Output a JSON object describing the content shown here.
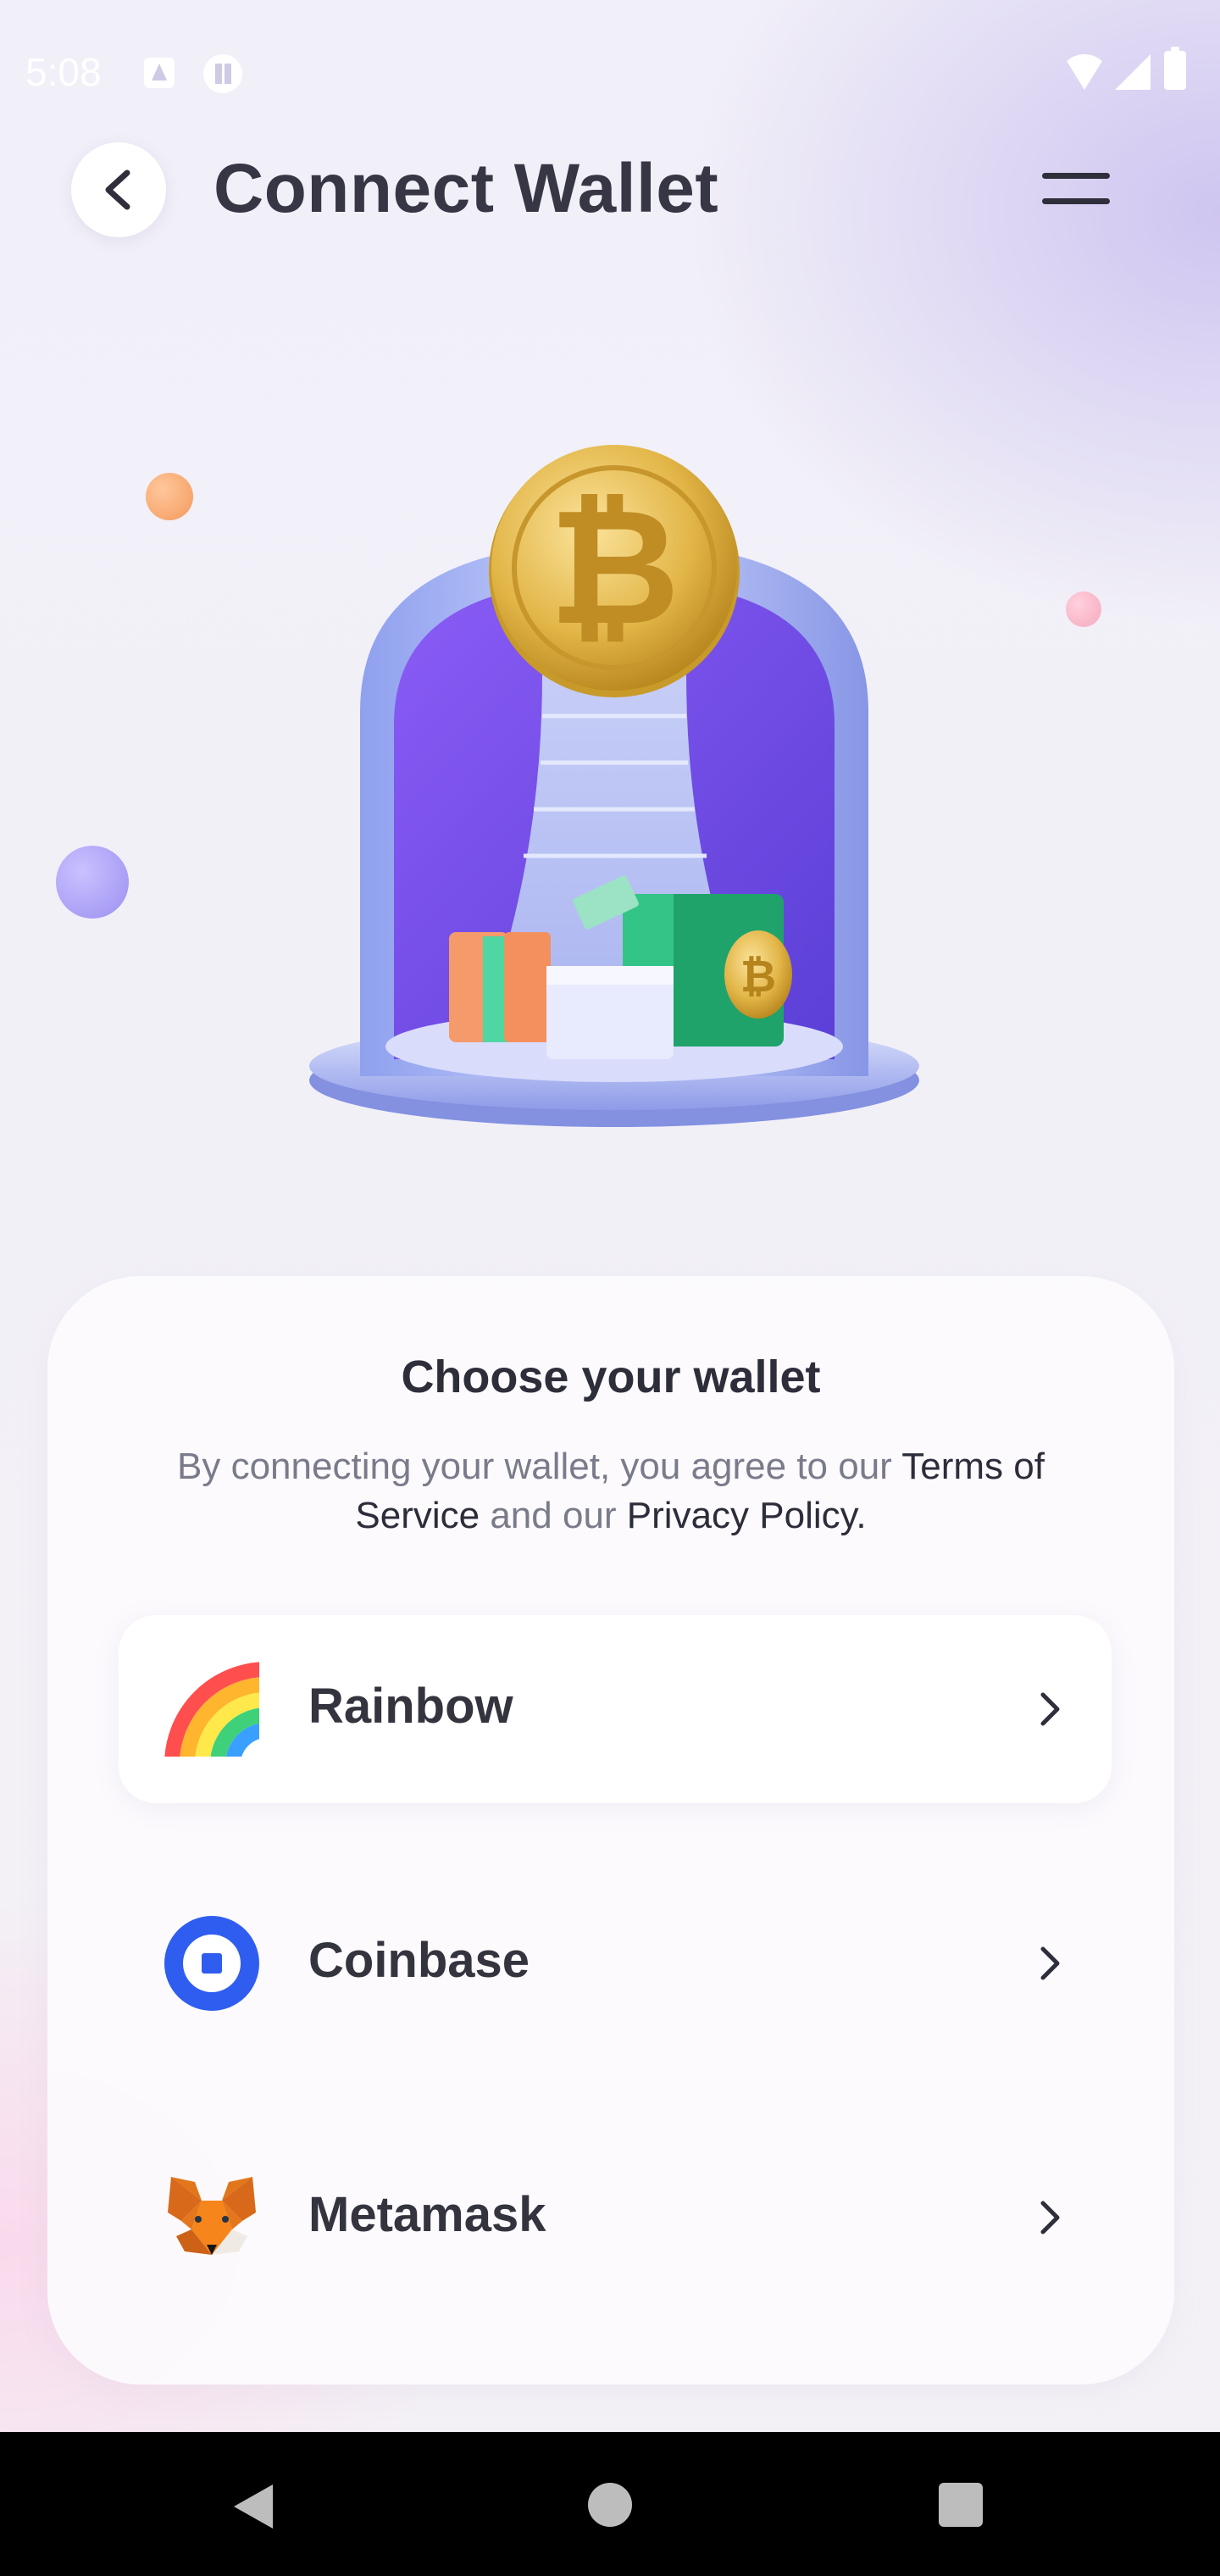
{
  "status_bar": {
    "time": "5:08"
  },
  "header": {
    "title": "Connect Wallet"
  },
  "card": {
    "heading": "Choose your wallet",
    "terms_prefix": "By connecting your wallet, you agree to our ",
    "terms_link": "Terms of Service",
    "terms_middle": " and our ",
    "privacy_link": "Privacy Policy."
  },
  "wallets": [
    {
      "name": "Rainbow",
      "icon": "rainbow-logo"
    },
    {
      "name": "Coinbase",
      "icon": "coinbase-logo"
    },
    {
      "name": "Metamask",
      "icon": "metamask-fox-logo"
    }
  ],
  "colors": {
    "accent_purple": "#8c6cf0",
    "coinbase_blue": "#2f5df0",
    "coin_gold": "#e0b040",
    "text_dark": "#363645"
  }
}
